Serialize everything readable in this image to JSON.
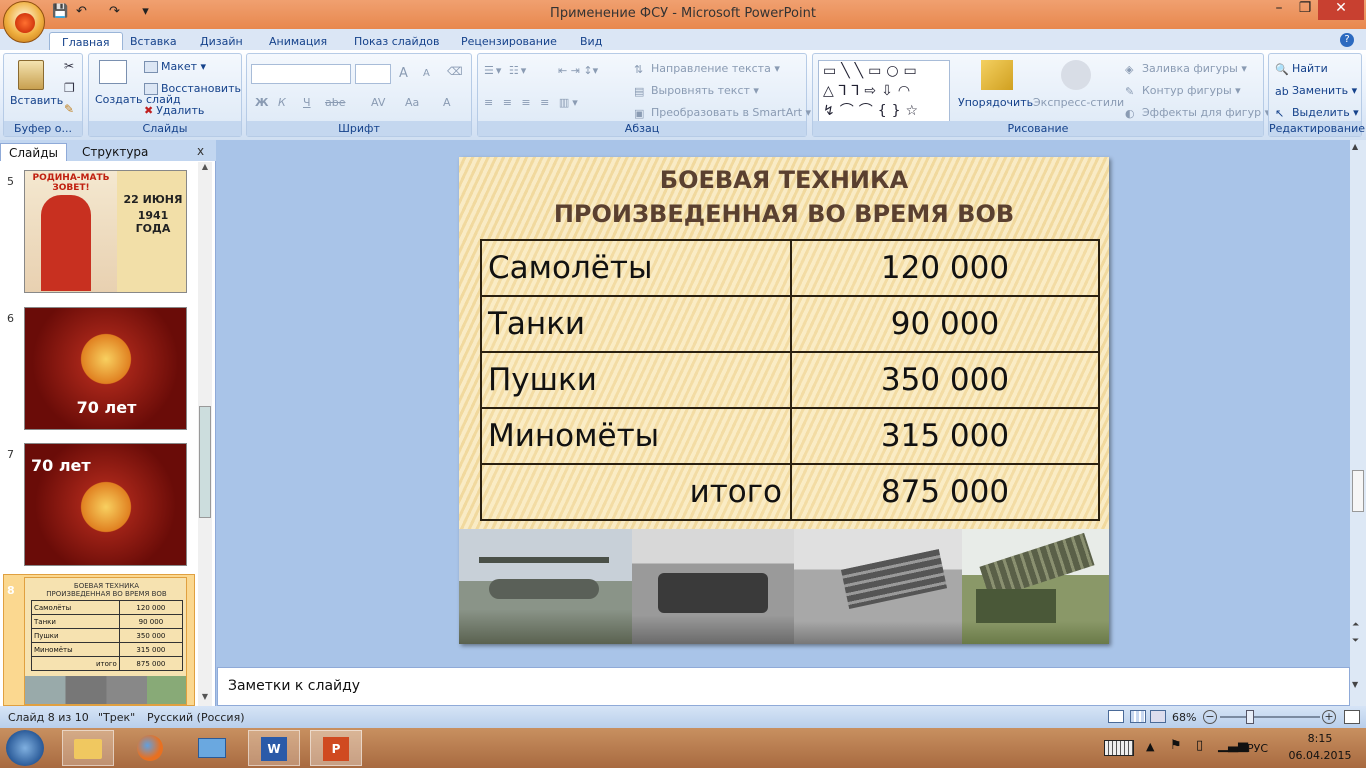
{
  "window": {
    "title": "Применение ФСУ - Microsoft PowerPoint",
    "controls": {
      "minimize": "–",
      "maximize": "❐",
      "close": "✕"
    }
  },
  "quick_access": {
    "save": "💾",
    "undo": "↶",
    "redo": "↷",
    "more": "▾"
  },
  "tabs": [
    "Главная",
    "Вставка",
    "Дизайн",
    "Анимация",
    "Показ слайдов",
    "Рецензирование",
    "Вид"
  ],
  "ribbon": {
    "clipboard": {
      "paste": "Вставить",
      "label": "Буфер о..."
    },
    "slides": {
      "new_slide": "Создать слайд",
      "layout": "Макет",
      "reset": "Восстановить",
      "delete": "Удалить",
      "label": "Слайды"
    },
    "font": {
      "label": "Шрифт",
      "bold": "Ж",
      "italic": "К",
      "underline": "Ч",
      "strike": "abe",
      "spacing": "AV",
      "case": "Aa",
      "color": "A",
      "grow": "A",
      "shrink": "A"
    },
    "paragraph": {
      "text_direction": "Направление текста",
      "align_text": "Выровнять текст",
      "smartart": "Преобразовать в SmartArt",
      "label": "Абзац"
    },
    "drawing": {
      "arrange": "Упорядочить",
      "quick_styles": "Экспресс-стили",
      "fill": "Заливка фигуры",
      "outline": "Контур фигуры",
      "effects": "Эффекты для фигур",
      "label": "Рисование"
    },
    "editing": {
      "find": "Найти",
      "replace": "Заменить",
      "select": "Выделить",
      "label": "Редактирование"
    }
  },
  "left_panel": {
    "tab_slides": "Слайды",
    "tab_outline": "Структура",
    "close": "x",
    "thumbs": [
      {
        "num": "5",
        "poster_text": "РОДИНА-МАТЬ ЗОВЕТ!",
        "date_line1": "22 ИЮНЯ",
        "date_line2": "1941 ГОДА"
      },
      {
        "num": "6",
        "caption": "70 лет"
      },
      {
        "num": "7",
        "caption": "70 лет"
      },
      {
        "num": "8",
        "title_line1": "БОЕВАЯ ТЕХНИКА",
        "title_line2": "ПРОИЗВЕДЕННАЯ ВО ВРЕМЯ ВОВ"
      }
    ]
  },
  "slide": {
    "title_line1": "БОЕВАЯ ТЕХНИКА",
    "title_line2": "ПРОИЗВЕДЕННАЯ ВО ВРЕМЯ ВОВ",
    "rows": [
      {
        "name": "Самолёты",
        "value": "120 000"
      },
      {
        "name": "Танки",
        "value": "90 000"
      },
      {
        "name": "Пушки",
        "value": "350 000"
      },
      {
        "name": "Миномёты",
        "value": "315 000"
      }
    ],
    "total_label": "итого",
    "total_value": "875 000"
  },
  "notes": {
    "placeholder": "Заметки к слайду"
  },
  "status": {
    "slide": "Слайд 8 из 10",
    "theme": "\"Трек\"",
    "language": "Русский (Россия)",
    "zoom": "68%",
    "zoom_level": 0.68
  },
  "taskbar": {
    "lang": "РУС",
    "time": "8:15",
    "date": "06.04.2015"
  }
}
